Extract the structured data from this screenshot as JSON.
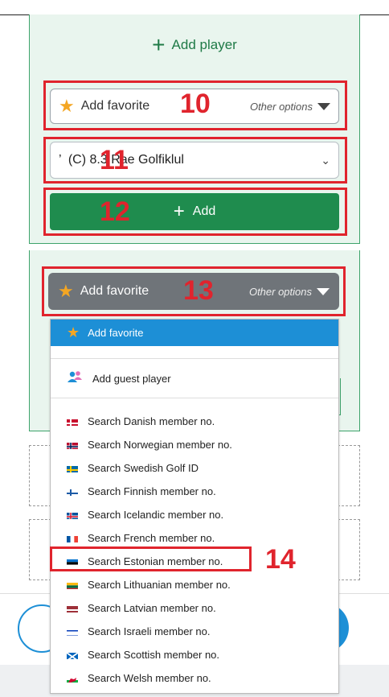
{
  "top_panel": {
    "add_player_label": "Add player",
    "favorite_label": "Add favorite",
    "other_options": "Other options",
    "select_text": "’  (C) 8.3 Rae Golfiklul",
    "add_button_label": "Add"
  },
  "annotations": {
    "n10": "10",
    "n11": "11",
    "n12": "12",
    "n13": "13",
    "n14": "14"
  },
  "bottom_panel": {
    "favorite_label": "Add favorite",
    "other_options": "Other options"
  },
  "dropdown": {
    "favorite_label": "Add favorite",
    "guest_label": "Add guest player",
    "items": [
      {
        "label": "Search Danish member no.",
        "flag": "dk"
      },
      {
        "label": "Search Norwegian member no.",
        "flag": "no"
      },
      {
        "label": "Search Swedish Golf ID",
        "flag": "se"
      },
      {
        "label": "Search Finnish member no.",
        "flag": "fi"
      },
      {
        "label": "Search Icelandic member no.",
        "flag": "is"
      },
      {
        "label": "Search French member no.",
        "flag": "fr"
      },
      {
        "label": "Search Estonian member no.",
        "flag": "ee"
      },
      {
        "label": "Search Lithuanian member no.",
        "flag": "lt"
      },
      {
        "label": "Search Latvian member no.",
        "flag": "lv"
      },
      {
        "label": "Search Israeli member no.",
        "flag": "il"
      },
      {
        "label": "Search Scottish member no.",
        "flag": "sc"
      },
      {
        "label": "Search Welsh member no.",
        "flag": "wa"
      }
    ]
  },
  "colors": {
    "accent_green": "#1f8c4e",
    "panel_bg": "#e9f5ee",
    "highlight_blue": "#1d8fd6",
    "annotation_red": "#e0242d"
  }
}
